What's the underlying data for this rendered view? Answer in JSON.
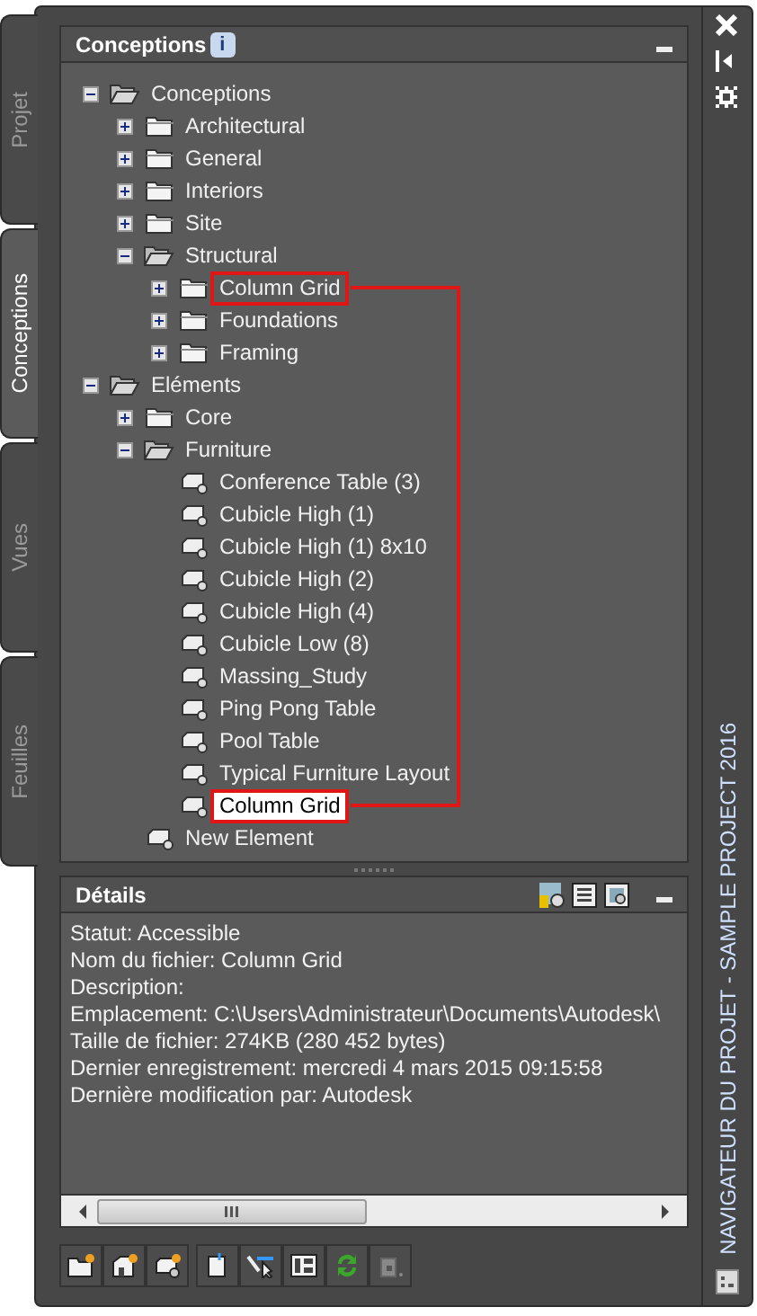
{
  "left_tabs": [
    {
      "label": "Projet",
      "selected": false
    },
    {
      "label": "Conceptions",
      "selected": true
    },
    {
      "label": "Vues",
      "selected": false
    },
    {
      "label": "Feuilles",
      "selected": false
    }
  ],
  "tree_panel": {
    "title": "Conceptions",
    "title_badge": "i",
    "items": [
      {
        "label": "Conceptions",
        "kind": "folder",
        "expanded": true,
        "selected": false,
        "outlined": false,
        "children": [
          {
            "label": "Architectural",
            "kind": "folder",
            "expanded": false,
            "selected": false,
            "outlined": false
          },
          {
            "label": "General",
            "kind": "folder",
            "expanded": false,
            "selected": false,
            "outlined": false
          },
          {
            "label": "Interiors",
            "kind": "folder",
            "expanded": false,
            "selected": false,
            "outlined": false
          },
          {
            "label": "Site",
            "kind": "folder",
            "expanded": false,
            "selected": false,
            "outlined": false
          },
          {
            "label": "Structural",
            "kind": "folder",
            "expanded": true,
            "selected": false,
            "outlined": false,
            "children": [
              {
                "label": "Column Grid",
                "kind": "folder",
                "expanded": false,
                "selected": false,
                "outlined": true
              },
              {
                "label": "Foundations",
                "kind": "folder",
                "expanded": false,
                "selected": false,
                "outlined": false
              },
              {
                "label": "Framing",
                "kind": "folder",
                "expanded": false,
                "selected": false,
                "outlined": false
              }
            ]
          }
        ]
      },
      {
        "label": "Eléments",
        "kind": "folder",
        "expanded": true,
        "selected": false,
        "outlined": false,
        "children": [
          {
            "label": "Core",
            "kind": "folder",
            "expanded": false,
            "selected": false,
            "outlined": false
          },
          {
            "label": "Furniture",
            "kind": "folder",
            "expanded": true,
            "selected": false,
            "outlined": false,
            "children": [
              {
                "label": "Conference Table (3)",
                "kind": "element",
                "selected": false,
                "outlined": false
              },
              {
                "label": "Cubicle High (1)",
                "kind": "element",
                "selected": false,
                "outlined": false
              },
              {
                "label": "Cubicle High (1) 8x10",
                "kind": "element",
                "selected": false,
                "outlined": false
              },
              {
                "label": "Cubicle High (2)",
                "kind": "element",
                "selected": false,
                "outlined": false
              },
              {
                "label": "Cubicle High (4)",
                "kind": "element",
                "selected": false,
                "outlined": false
              },
              {
                "label": "Cubicle Low (8)",
                "kind": "element",
                "selected": false,
                "outlined": false
              },
              {
                "label": "Massing_Study",
                "kind": "element",
                "selected": false,
                "outlined": false
              },
              {
                "label": "Ping Pong Table",
                "kind": "element",
                "selected": false,
                "outlined": false
              },
              {
                "label": "Pool Table",
                "kind": "element",
                "selected": false,
                "outlined": false
              },
              {
                "label": "Typical Furniture Layout",
                "kind": "element",
                "selected": false,
                "outlined": false
              },
              {
                "label": "Column Grid",
                "kind": "element",
                "selected": true,
                "outlined": true
              }
            ]
          },
          {
            "label": "New Element",
            "kind": "element",
            "selected": false,
            "outlined": false
          }
        ]
      }
    ]
  },
  "details_panel": {
    "title": "Détails",
    "lines": [
      "Statut: Accessible",
      "Nom du fichier: Column Grid",
      "Description:",
      "Emplacement: C:\\Users\\Administrateur\\Documents\\Autodesk\\",
      "Taille de fichier: 274KB (280 452 bytes)",
      "Dernier enregistrement: mercredi 4 mars 2015  09:15:58",
      "Dernière modification par: Autodesk"
    ]
  },
  "palette_title": "NAVIGATEUR DU PROJET - SAMPLE PROJECT 2016"
}
